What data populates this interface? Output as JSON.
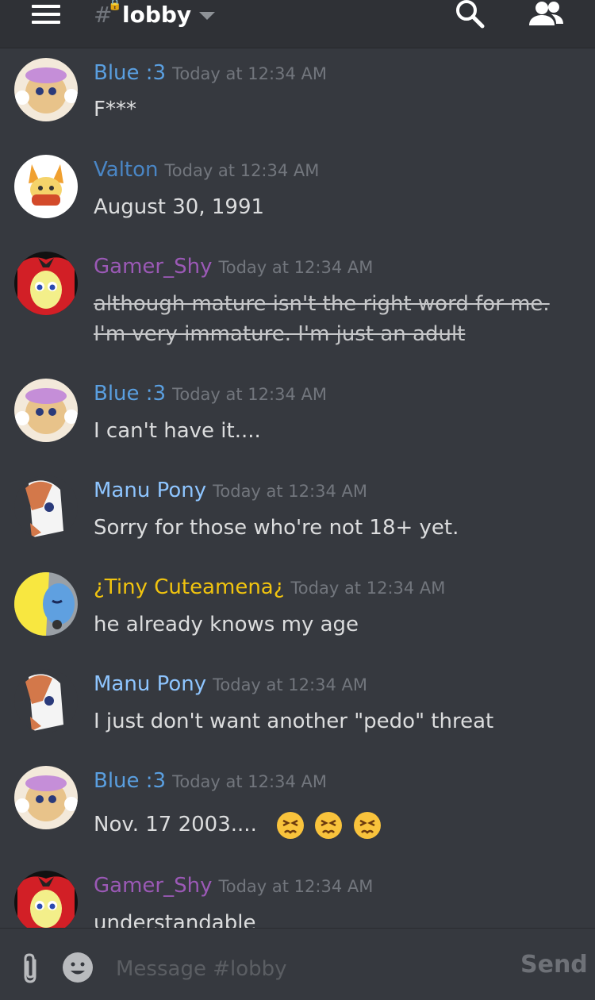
{
  "header": {
    "channel_symbol": "#",
    "channel_name": "lobby"
  },
  "colors": {
    "background": "#36393f",
    "topbar": "#2f3136",
    "timestamp": "#72767d",
    "blue_user": "#5a9fe0",
    "valton": "#4a86c5",
    "gamer_shy": "#9b59b6",
    "manu_pony": "#8ec5ff",
    "tiny": "#f1c40f"
  },
  "messages": [
    {
      "user": "Blue :3",
      "timestamp": "Today at 12:34 AM",
      "text": "F***",
      "avatar": "blue-avatar"
    },
    {
      "user": "Valton",
      "timestamp": "Today at 12:34 AM",
      "text": "August 30, 1991",
      "avatar": "fennekin-avatar"
    },
    {
      "user": "Gamer_Shy",
      "timestamp": "Today at 12:34 AM",
      "text": "although mature isn't the right word for me. I'm very immature. I'm just an adult",
      "strikethrough": true,
      "avatar": "pony-red-mane-avatar"
    },
    {
      "user": "Blue :3",
      "timestamp": "Today at 12:34 AM",
      "text": "I can't have it....",
      "avatar": "blue-avatar"
    },
    {
      "user": "Manu Pony",
      "timestamp": "Today at 12:34 AM",
      "text": "Sorry for those who're not 18+ yet.",
      "avatar": "white-pony-avatar"
    },
    {
      "user": "¿Tiny Cuteamena¿",
      "timestamp": "Today at 12:34 AM",
      "text": "he already knows my age",
      "avatar": "yellow-blue-pony-avatar"
    },
    {
      "user": "Manu Pony",
      "timestamp": "Today at 12:34 AM",
      "text": "I just don't want another \"pedo\" threat",
      "avatar": "white-pony-avatar"
    },
    {
      "user": "Blue :3",
      "timestamp": "Today at 12:34 AM",
      "text": "Nov. 17 2003....",
      "emojis": [
        "persevering-face",
        "persevering-face",
        "persevering-face"
      ],
      "avatar": "blue-avatar"
    },
    {
      "user": "Gamer_Shy",
      "timestamp": "Today at 12:34 AM",
      "text": "understandable",
      "avatar": "pony-red-mane-avatar"
    }
  ],
  "composer": {
    "placeholder": "Message #lobby",
    "send_label": "Send"
  }
}
